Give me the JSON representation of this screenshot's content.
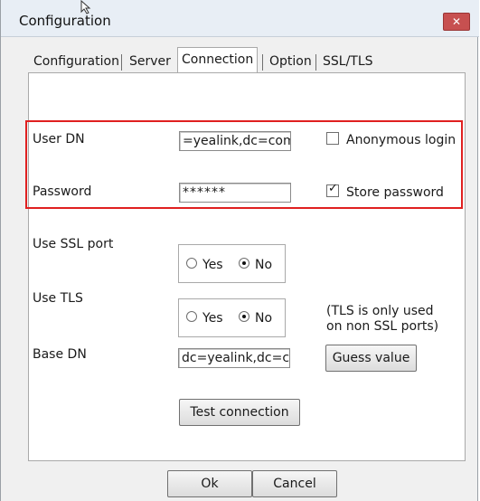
{
  "window": {
    "title": "Configuration",
    "close_glyph": "✕"
  },
  "tabs": [
    {
      "label": "Configuration"
    },
    {
      "label": "Server"
    },
    {
      "label": "Connection"
    },
    {
      "label": "Option"
    },
    {
      "label": "SSL/TLS"
    }
  ],
  "form": {
    "user_dn_label": "User DN",
    "user_dn_value": "=yealink,dc=com",
    "anonymous_login_label": "Anonymous login",
    "anonymous_login_checked": false,
    "password_label": "Password",
    "password_value": "******",
    "store_password_label": "Store password",
    "store_password_checked": true,
    "ssl_port_label": "Use SSL port",
    "ssl_yes": "Yes",
    "ssl_no": "No",
    "ssl_selected": "No",
    "tls_label": "Use TLS",
    "tls_yes": "Yes",
    "tls_no": "No",
    "tls_selected": "No",
    "tls_note_line1": "(TLS is only used",
    "tls_note_line2": "on non SSL ports)",
    "base_dn_label": "Base DN",
    "base_dn_value": "dc=yealink,dc=c",
    "guess_value_button": "Guess value",
    "test_connection_button": "Test connection"
  },
  "footer": {
    "ok": "Ok",
    "cancel": "Cancel"
  },
  "colors": {
    "highlight": "#e02020"
  }
}
